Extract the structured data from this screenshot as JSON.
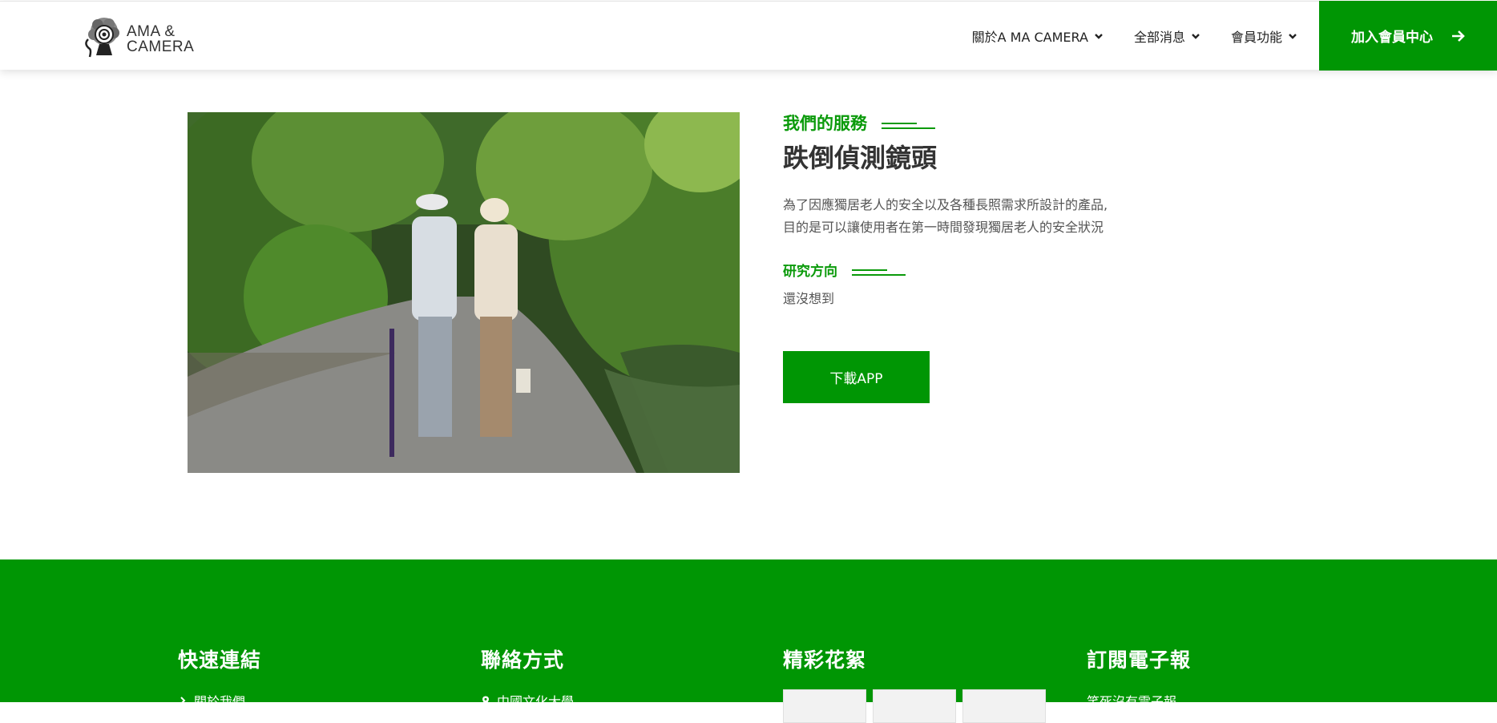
{
  "header": {
    "logo": {
      "line1": "AMA &",
      "line2": "CAMERA"
    },
    "nav": [
      {
        "label": "關於A MA CAMERA"
      },
      {
        "label": "全部消息"
      },
      {
        "label": "會員功能"
      }
    ],
    "join_label": "加入會員中心"
  },
  "service": {
    "eyebrow": "我們的服務",
    "title": "跌倒偵測鏡頭",
    "desc_line1": "為了因應獨居老人的安全以及各種長照需求所設計的產品,",
    "desc_line2": "目的是可以讓使用者在第一時間發現獨居老人的安全狀況",
    "research_label": "研究方向",
    "research_text": "還沒想到",
    "download_label": "下載APP"
  },
  "footer": {
    "quick_links": {
      "heading": "快速連結",
      "first_link": "關於我們"
    },
    "contact": {
      "heading": "聯絡方式",
      "first_line": "中國文化大學"
    },
    "gallery": {
      "heading": "精彩花絮"
    },
    "newsletter": {
      "heading": "訂閱電子報",
      "first_line": "笑死沒有電子報"
    }
  },
  "colors": {
    "brand_green": "#009604",
    "accent_text_green": "#0a9a0a"
  }
}
